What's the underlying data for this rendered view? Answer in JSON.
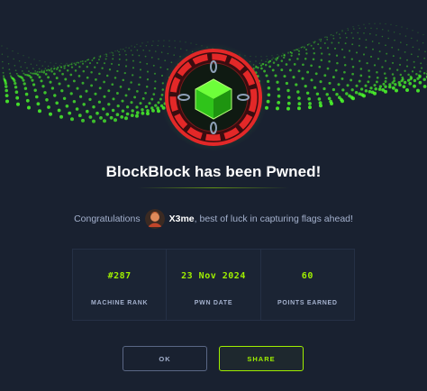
{
  "modal": {
    "title": "BlockBlock has been Pwned!",
    "congrats_prefix": "Congratulations",
    "username": "X3me",
    "congrats_suffix": ", best of luck in capturing flags ahead!"
  },
  "stats": [
    {
      "value": "#287",
      "label": "MACHINE RANK"
    },
    {
      "value": "23 Nov 2024",
      "label": "PWN DATE"
    },
    {
      "value": "60",
      "label": "POINTS EARNED"
    }
  ],
  "buttons": {
    "ok": "OK",
    "share": "SHARE"
  },
  "colors": {
    "background": "#192130",
    "accent_green": "#9fef00",
    "badge_red": "#e32828",
    "text_muted": "#a4b1cd"
  },
  "icons": {
    "badge": "blockchain-cube-badge-icon",
    "avatar": "user-avatar"
  }
}
